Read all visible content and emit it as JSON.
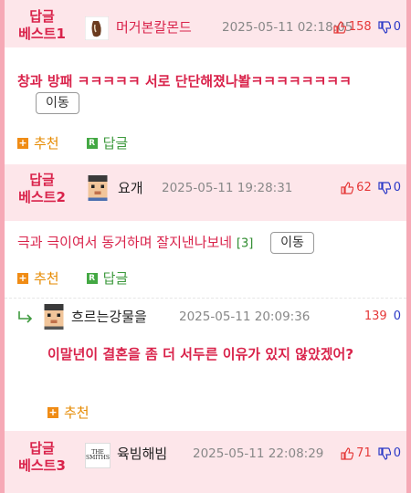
{
  "best1": {
    "label": "답글\n베스트1",
    "nick": "머거본칼몬드",
    "date": "2025-05-11 02:18:05",
    "up": "158",
    "down": "0",
    "content": "창과 방패 ㅋㅋㅋㅋㅋ 서로 단단해졌나봘ㅋㅋㅋㅋㅋㅋㅋㅋ",
    "move": "이동",
    "recommend": "추천",
    "reply": "답글"
  },
  "best2": {
    "label": "답글\n베스트2",
    "nick": "요개",
    "date": "2025-05-11 19:28:31",
    "up": "62",
    "down": "0",
    "content": "극과 극이여서 동거하며 잘지낸나보네",
    "comment_count": "[3]",
    "move": "이동",
    "recommend": "추천",
    "reply": "답글"
  },
  "subreply": {
    "nick": "흐르는강물을",
    "date": "2025-05-11 20:09:36",
    "up": "139",
    "down": "0",
    "content": "이말년이 결혼을 좀 더 서두른 이유가 있지 않았겠어?",
    "recommend": "추천"
  },
  "best3": {
    "label": "답글\n베스트3",
    "nick": "육빔해빔",
    "avatar_text": "THE\nSMITHS",
    "date": "2025-05-11 22:08:29",
    "up": "71",
    "down": "0"
  },
  "colors": {
    "accent": "#d9234b",
    "best_bg": "#fde6ea",
    "frame_bg": "#f6a9b6",
    "up": "#e53939",
    "down": "#2b39c7",
    "recommend": "#e68a00",
    "reply": "#3e9a3e"
  },
  "icons": [
    "thumbs-up-icon",
    "thumbs-down-icon",
    "plus-square-icon",
    "reply-square-icon",
    "reply-arrow-icon",
    "avatar-icon"
  ]
}
